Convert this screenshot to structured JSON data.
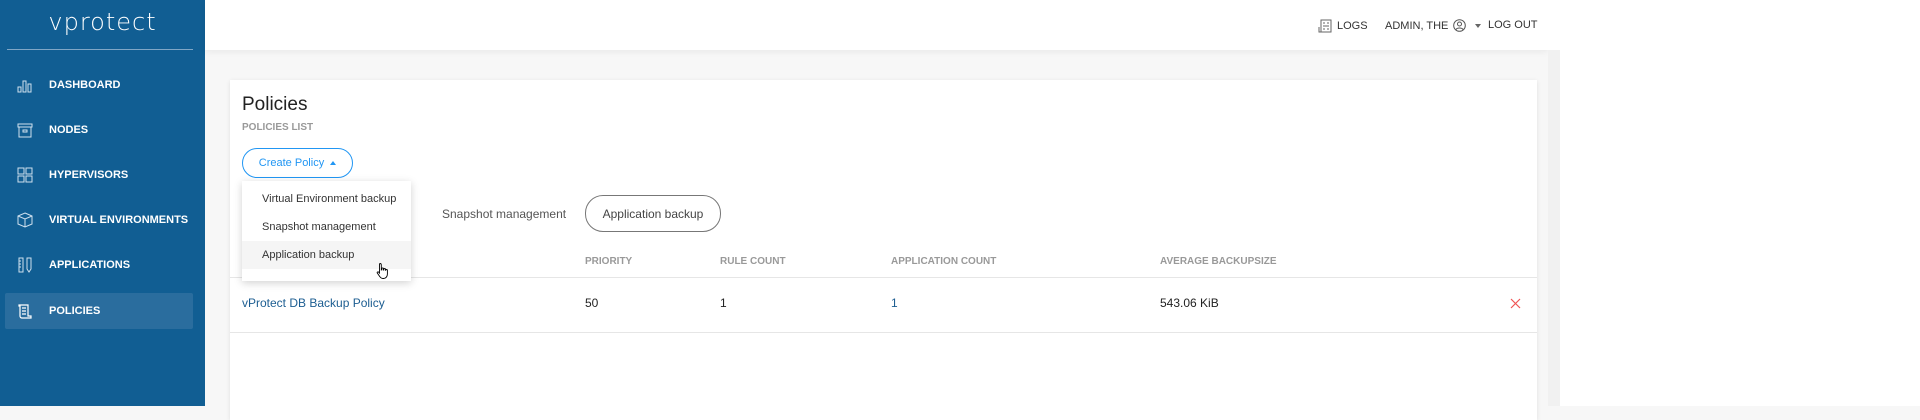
{
  "app": {
    "logo": "vprotect"
  },
  "sidebar": {
    "items": [
      {
        "label": "DASHBOARD",
        "icon": "bar-chart-icon"
      },
      {
        "label": "NODES",
        "icon": "archive-box-icon"
      },
      {
        "label": "HYPERVISORS",
        "icon": "grid-icon"
      },
      {
        "label": "VIRTUAL ENVIRONMENTS",
        "icon": "cube-icon"
      },
      {
        "label": "APPLICATIONS",
        "icon": "ruler-pencil-icon"
      },
      {
        "label": "POLICIES",
        "icon": "scroll-icon",
        "active": true
      }
    ]
  },
  "header": {
    "logs": "LOGS",
    "user": "ADMIN, THE",
    "logout": "LOG OUT"
  },
  "page": {
    "title": "Policies",
    "subtitle": "POLICIES LIST",
    "create_button": "Create Policy",
    "dropdown": [
      "Virtual Environment backup",
      "Snapshot management",
      "Application backup"
    ],
    "tabs": [
      "Snapshot management",
      "Application backup"
    ],
    "active_tab": "Application backup"
  },
  "table": {
    "columns": [
      "PRIORITY",
      "RULE COUNT",
      "APPLICATION COUNT",
      "AVERAGE BACKUPSIZE"
    ],
    "rows": [
      {
        "name": "vProtect DB Backup Policy",
        "priority": "50",
        "rule_count": "1",
        "application_count": "1",
        "average_backupsize": "543.06 KiB"
      }
    ]
  },
  "colors": {
    "sidebar": "#115e93",
    "accent": "#2196f3",
    "delete": "#f05454"
  }
}
